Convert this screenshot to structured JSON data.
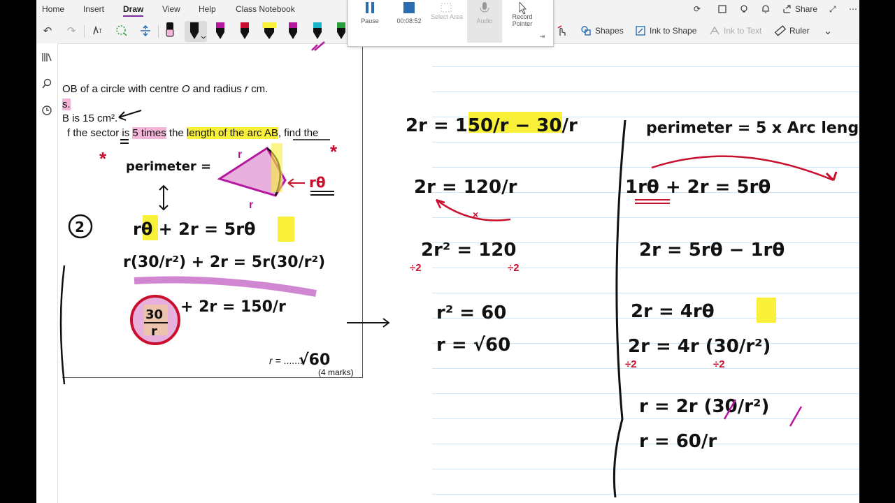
{
  "ribbon": {
    "tabs": [
      "Home",
      "Insert",
      "Draw",
      "View",
      "Help",
      "Class Notebook"
    ],
    "active_tab": "Draw",
    "tools_right": {
      "shapes": "Shapes",
      "ink_to_shape": "Ink to Shape",
      "ink_to_text": "Ink to Text",
      "ruler": "Ruler"
    },
    "share": "Share"
  },
  "recorder": {
    "pause": "Pause",
    "time": "00:08:52",
    "select_area": "Select Area",
    "audio": "Audio",
    "record_pointer": "Record Pointer"
  },
  "question": {
    "line1_pre": "OB of a circle with centre ",
    "line1_var1": "O",
    "line1_mid": " and radius ",
    "line1_var2": "r",
    "line1_post": " cm.",
    "line2": "s.",
    "line3": "B is 15 cm².",
    "line4_pre": "f the sector is ",
    "line4_hl1": "5 times",
    "line4_mid": " the ",
    "line4_hl2": "length of the arc AB",
    "line4_post": ", find the",
    "answer_label": "r = ",
    "answer_dots": "........",
    "marks": "(4 marks)"
  },
  "handwriting": {
    "perimeter_label": "perimeter =",
    "arc_label": "rθ",
    "step_number": "2",
    "mid_col": [
      "2r = 150/r − 30/r",
      "2r = 120/r",
      "2r² = 120",
      "r² = 60",
      "r = √60"
    ],
    "right_col_header": "perimeter = 5 x Arc leng",
    "right_col": [
      "1rθ + 2r = 5rθ",
      "2r = 5rθ − 1rθ",
      "2r = 4rθ",
      "2r = 4r (30/r²)",
      "r = 2r (30/r²)",
      "r = 60/r"
    ],
    "answer_value": "√60"
  },
  "colors": {
    "accent": "#7a2d9c",
    "highlight_yellow": "#f9f03a",
    "highlight_pink": "#f3b6d8",
    "ink_red": "#c8102e",
    "ink_magenta": "#b5179e"
  }
}
